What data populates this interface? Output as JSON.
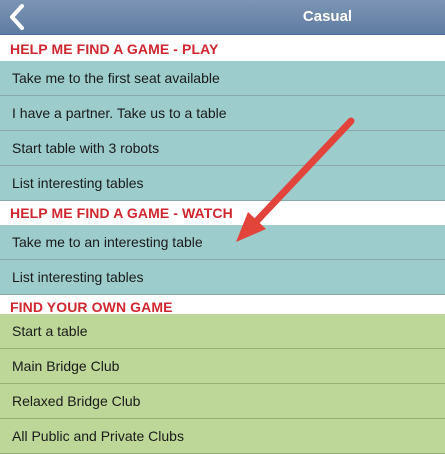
{
  "nav": {
    "title": "Casual",
    "back_icon": "chevron-left-icon"
  },
  "sections": {
    "play": {
      "header": "HELP ME FIND A GAME - PLAY",
      "items": [
        "Take me to the first seat available",
        "I have a partner. Take us to a table",
        "Start table with 3 robots",
        "List interesting tables"
      ]
    },
    "watch": {
      "header": "HELP ME FIND A GAME - WATCH",
      "items": [
        "Take me to an interesting table",
        "List interesting tables"
      ]
    },
    "own": {
      "header": "FIND YOUR OWN GAME",
      "items": [
        "Start a table",
        "Main Bridge Club",
        "Relaxed Bridge Club",
        "All Public and Private Clubs"
      ]
    }
  },
  "colors": {
    "nav_bar": "#6a86ab",
    "section_header_text": "#d0262f",
    "teal_row": "#9ccccc",
    "green_row": "#bcd797",
    "annotation_arrow": "#e2433a"
  },
  "annotation": {
    "type": "arrow",
    "icon": "red-arrow-icon"
  }
}
